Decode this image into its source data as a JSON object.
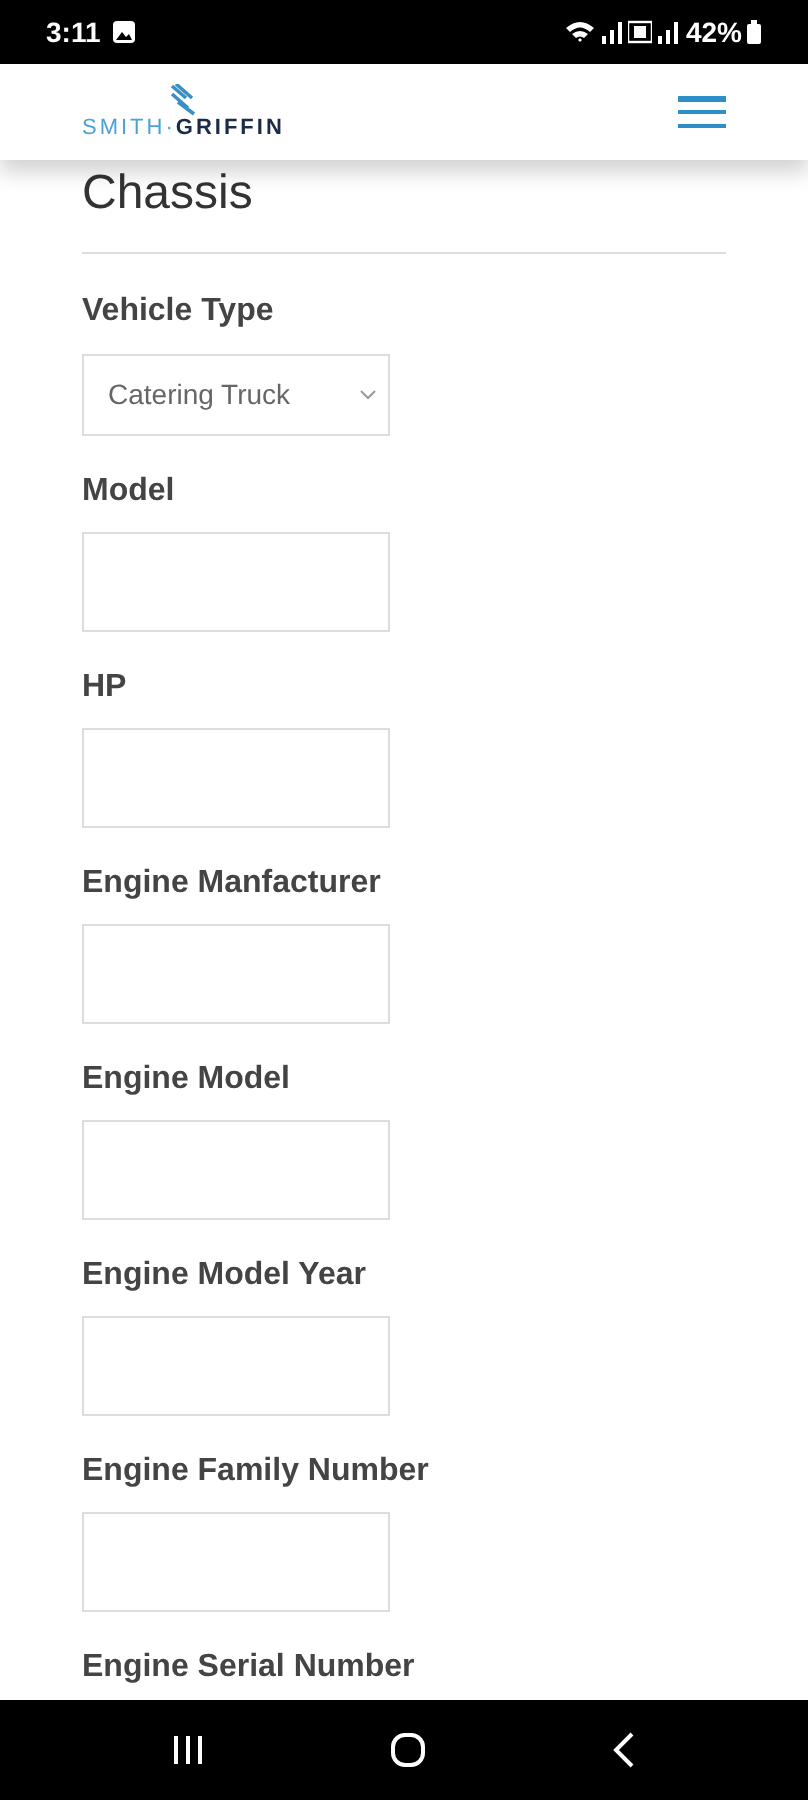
{
  "status_bar": {
    "time": "3:11",
    "battery": "42%"
  },
  "header": {
    "logo": {
      "part_1": "SMITH·",
      "part_2": "GRIFFIN"
    }
  },
  "section": {
    "title": "Chassis"
  },
  "fields": [
    {
      "label": "Vehicle Type",
      "kind": "select",
      "value": "Catering Truck"
    },
    {
      "label": "Model",
      "kind": "text"
    },
    {
      "label": "HP",
      "kind": "text"
    },
    {
      "label": "Engine Manfacturer",
      "kind": "text"
    },
    {
      "label": "Engine Model",
      "kind": "text"
    },
    {
      "label": "Engine Model Year",
      "kind": "text"
    },
    {
      "label": "Engine Family Number",
      "kind": "text"
    },
    {
      "label": "Engine Serial Number",
      "kind": "label_only"
    }
  ]
}
